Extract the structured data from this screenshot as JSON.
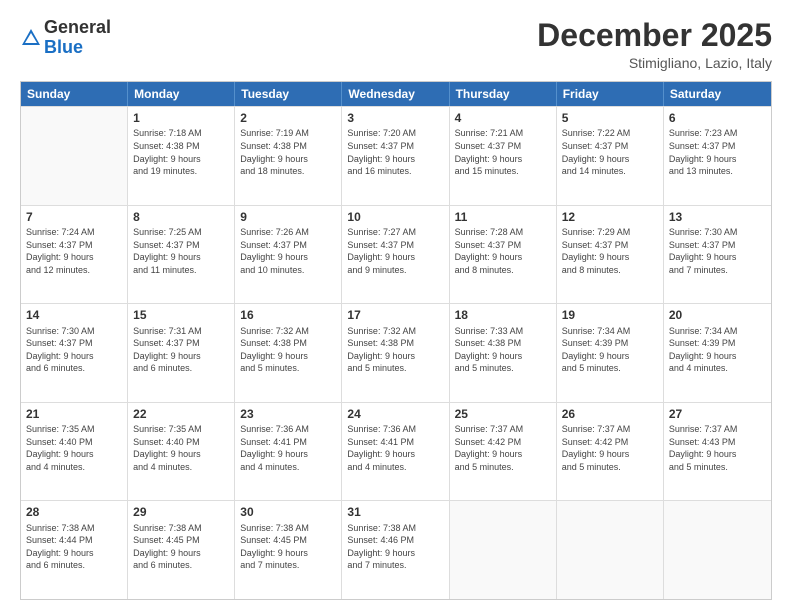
{
  "logo": {
    "general": "General",
    "blue": "Blue"
  },
  "header": {
    "month": "December 2025",
    "location": "Stimigliano, Lazio, Italy"
  },
  "days": [
    "Sunday",
    "Monday",
    "Tuesday",
    "Wednesday",
    "Thursday",
    "Friday",
    "Saturday"
  ],
  "weeks": [
    [
      {
        "day": "",
        "content": ""
      },
      {
        "day": "1",
        "content": "Sunrise: 7:18 AM\nSunset: 4:38 PM\nDaylight: 9 hours\nand 19 minutes."
      },
      {
        "day": "2",
        "content": "Sunrise: 7:19 AM\nSunset: 4:38 PM\nDaylight: 9 hours\nand 18 minutes."
      },
      {
        "day": "3",
        "content": "Sunrise: 7:20 AM\nSunset: 4:37 PM\nDaylight: 9 hours\nand 16 minutes."
      },
      {
        "day": "4",
        "content": "Sunrise: 7:21 AM\nSunset: 4:37 PM\nDaylight: 9 hours\nand 15 minutes."
      },
      {
        "day": "5",
        "content": "Sunrise: 7:22 AM\nSunset: 4:37 PM\nDaylight: 9 hours\nand 14 minutes."
      },
      {
        "day": "6",
        "content": "Sunrise: 7:23 AM\nSunset: 4:37 PM\nDaylight: 9 hours\nand 13 minutes."
      }
    ],
    [
      {
        "day": "7",
        "content": "Sunrise: 7:24 AM\nSunset: 4:37 PM\nDaylight: 9 hours\nand 12 minutes."
      },
      {
        "day": "8",
        "content": "Sunrise: 7:25 AM\nSunset: 4:37 PM\nDaylight: 9 hours\nand 11 minutes."
      },
      {
        "day": "9",
        "content": "Sunrise: 7:26 AM\nSunset: 4:37 PM\nDaylight: 9 hours\nand 10 minutes."
      },
      {
        "day": "10",
        "content": "Sunrise: 7:27 AM\nSunset: 4:37 PM\nDaylight: 9 hours\nand 9 minutes."
      },
      {
        "day": "11",
        "content": "Sunrise: 7:28 AM\nSunset: 4:37 PM\nDaylight: 9 hours\nand 8 minutes."
      },
      {
        "day": "12",
        "content": "Sunrise: 7:29 AM\nSunset: 4:37 PM\nDaylight: 9 hours\nand 8 minutes."
      },
      {
        "day": "13",
        "content": "Sunrise: 7:30 AM\nSunset: 4:37 PM\nDaylight: 9 hours\nand 7 minutes."
      }
    ],
    [
      {
        "day": "14",
        "content": "Sunrise: 7:30 AM\nSunset: 4:37 PM\nDaylight: 9 hours\nand 6 minutes."
      },
      {
        "day": "15",
        "content": "Sunrise: 7:31 AM\nSunset: 4:37 PM\nDaylight: 9 hours\nand 6 minutes."
      },
      {
        "day": "16",
        "content": "Sunrise: 7:32 AM\nSunset: 4:38 PM\nDaylight: 9 hours\nand 5 minutes."
      },
      {
        "day": "17",
        "content": "Sunrise: 7:32 AM\nSunset: 4:38 PM\nDaylight: 9 hours\nand 5 minutes."
      },
      {
        "day": "18",
        "content": "Sunrise: 7:33 AM\nSunset: 4:38 PM\nDaylight: 9 hours\nand 5 minutes."
      },
      {
        "day": "19",
        "content": "Sunrise: 7:34 AM\nSunset: 4:39 PM\nDaylight: 9 hours\nand 5 minutes."
      },
      {
        "day": "20",
        "content": "Sunrise: 7:34 AM\nSunset: 4:39 PM\nDaylight: 9 hours\nand 4 minutes."
      }
    ],
    [
      {
        "day": "21",
        "content": "Sunrise: 7:35 AM\nSunset: 4:40 PM\nDaylight: 9 hours\nand 4 minutes."
      },
      {
        "day": "22",
        "content": "Sunrise: 7:35 AM\nSunset: 4:40 PM\nDaylight: 9 hours\nand 4 minutes."
      },
      {
        "day": "23",
        "content": "Sunrise: 7:36 AM\nSunset: 4:41 PM\nDaylight: 9 hours\nand 4 minutes."
      },
      {
        "day": "24",
        "content": "Sunrise: 7:36 AM\nSunset: 4:41 PM\nDaylight: 9 hours\nand 4 minutes."
      },
      {
        "day": "25",
        "content": "Sunrise: 7:37 AM\nSunset: 4:42 PM\nDaylight: 9 hours\nand 5 minutes."
      },
      {
        "day": "26",
        "content": "Sunrise: 7:37 AM\nSunset: 4:42 PM\nDaylight: 9 hours\nand 5 minutes."
      },
      {
        "day": "27",
        "content": "Sunrise: 7:37 AM\nSunset: 4:43 PM\nDaylight: 9 hours\nand 5 minutes."
      }
    ],
    [
      {
        "day": "28",
        "content": "Sunrise: 7:38 AM\nSunset: 4:44 PM\nDaylight: 9 hours\nand 6 minutes."
      },
      {
        "day": "29",
        "content": "Sunrise: 7:38 AM\nSunset: 4:45 PM\nDaylight: 9 hours\nand 6 minutes."
      },
      {
        "day": "30",
        "content": "Sunrise: 7:38 AM\nSunset: 4:45 PM\nDaylight: 9 hours\nand 7 minutes."
      },
      {
        "day": "31",
        "content": "Sunrise: 7:38 AM\nSunset: 4:46 PM\nDaylight: 9 hours\nand 7 minutes."
      },
      {
        "day": "",
        "content": ""
      },
      {
        "day": "",
        "content": ""
      },
      {
        "day": "",
        "content": ""
      }
    ]
  ]
}
